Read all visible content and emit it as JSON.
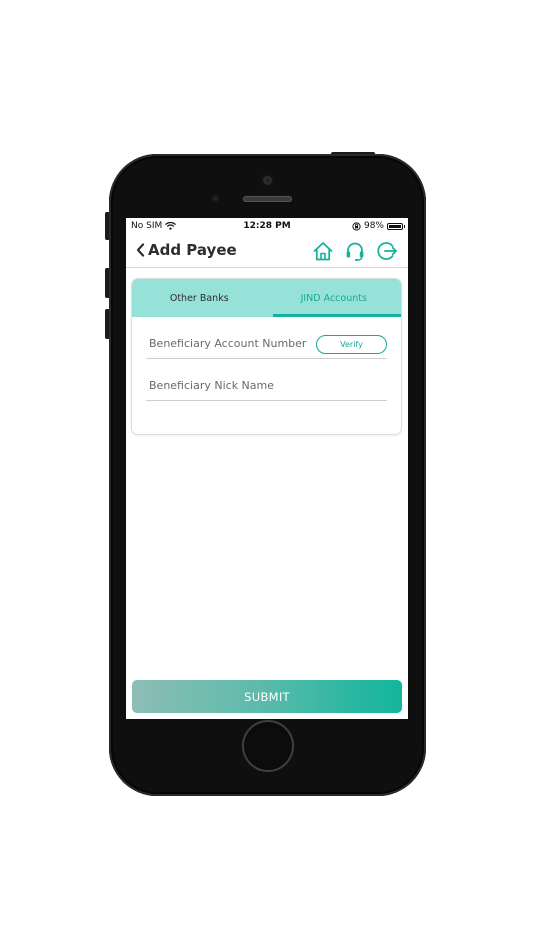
{
  "status_bar": {
    "carrier": "No SIM",
    "time": "12:28 PM",
    "battery": "98%",
    "battery_level": 0.98,
    "icons": [
      "wifi-icon",
      "orientation-lock-icon",
      "battery-icon"
    ]
  },
  "header": {
    "back_icon": "chevron-left-icon",
    "title": "Add Payee",
    "icons": [
      "home-icon",
      "headset-icon",
      "logout-icon"
    ]
  },
  "tabs": [
    {
      "label": "Other Banks",
      "active": false
    },
    {
      "label": "JIND Accounts",
      "active": true
    }
  ],
  "form": {
    "account_number_label": "Beneficiary Account Number",
    "verify_label": "Verify",
    "nick_name_label": "Beneficiary Nick Name"
  },
  "submit_label": "SUBMIT",
  "colors": {
    "accent": "#15b39c",
    "tab_bg": "#97e2d8",
    "submit_start": "#8dbdb6",
    "submit_end": "#12b59d"
  }
}
